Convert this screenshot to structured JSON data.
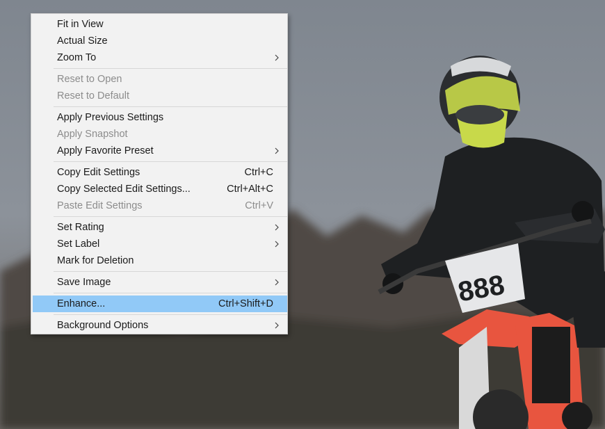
{
  "menu": {
    "items": [
      {
        "label": "Fit in View",
        "shortcut": "",
        "submenu": false,
        "disabled": false
      },
      {
        "label": "Actual Size",
        "shortcut": "",
        "submenu": false,
        "disabled": false
      },
      {
        "label": "Zoom To",
        "shortcut": "",
        "submenu": true,
        "disabled": false
      },
      {
        "label": "Reset to Open",
        "shortcut": "",
        "submenu": false,
        "disabled": true
      },
      {
        "label": "Reset to Default",
        "shortcut": "",
        "submenu": false,
        "disabled": true
      },
      {
        "label": "Apply Previous Settings",
        "shortcut": "",
        "submenu": false,
        "disabled": false
      },
      {
        "label": "Apply Snapshot",
        "shortcut": "",
        "submenu": false,
        "disabled": true
      },
      {
        "label": "Apply Favorite Preset",
        "shortcut": "",
        "submenu": true,
        "disabled": false
      },
      {
        "label": "Copy Edit Settings",
        "shortcut": "Ctrl+C",
        "submenu": false,
        "disabled": false
      },
      {
        "label": "Copy Selected Edit Settings...",
        "shortcut": "Ctrl+Alt+C",
        "submenu": false,
        "disabled": false
      },
      {
        "label": "Paste Edit Settings",
        "shortcut": "Ctrl+V",
        "submenu": false,
        "disabled": true
      },
      {
        "label": "Set Rating",
        "shortcut": "",
        "submenu": true,
        "disabled": false
      },
      {
        "label": "Set Label",
        "shortcut": "",
        "submenu": true,
        "disabled": false
      },
      {
        "label": "Mark for Deletion",
        "shortcut": "",
        "submenu": false,
        "disabled": false
      },
      {
        "label": "Save Image",
        "shortcut": "",
        "submenu": true,
        "disabled": false
      },
      {
        "label": "Enhance...",
        "shortcut": "Ctrl+Shift+D",
        "submenu": false,
        "disabled": false,
        "highlighted": true
      },
      {
        "label": "Background Options",
        "shortcut": "",
        "submenu": true,
        "disabled": false
      }
    ]
  },
  "photo": {
    "number_plate": "888",
    "colors": {
      "sky": "#8a9099",
      "trees": "#4a4642",
      "jacket": "#1e2022",
      "helmet_accent": "#c8d94a",
      "bike_red": "#e8553f"
    }
  },
  "colors": {
    "menu_bg": "#f2f2f2",
    "highlight": "#91c9f7",
    "disabled_text": "#8c8c8c"
  }
}
